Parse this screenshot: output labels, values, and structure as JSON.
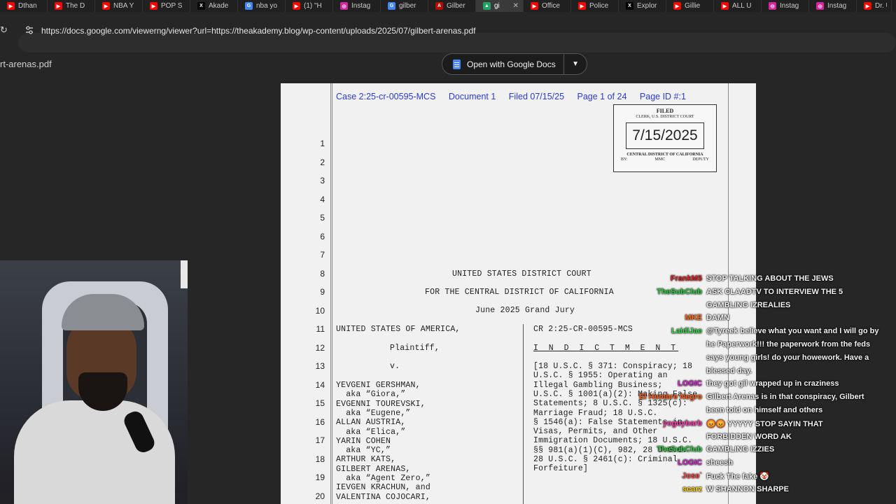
{
  "tabs": [
    {
      "title": "Dthan",
      "icon": "youtube-icon",
      "color": "#ff0000"
    },
    {
      "title": "The D",
      "icon": "youtube-icon",
      "color": "#ff0000"
    },
    {
      "title": "NBA Y",
      "icon": "youtube-icon",
      "color": "#ff0000"
    },
    {
      "title": "POP S",
      "icon": "youtube-icon",
      "color": "#ff0000"
    },
    {
      "title": "Akade",
      "icon": "x-icon",
      "color": "#000000"
    },
    {
      "title": "nba yo",
      "icon": "google-icon",
      "color": "#4285f4"
    },
    {
      "title": "(1) \"H",
      "icon": "youtube-icon",
      "color": "#ff0000"
    },
    {
      "title": "Instag",
      "icon": "instagram-icon",
      "color": "#d6249f"
    },
    {
      "title": "gilber",
      "icon": "google-icon",
      "color": "#4285f4"
    },
    {
      "title": "Gilber",
      "icon": "adobe-icon",
      "color": "#b30b00"
    },
    {
      "title": "gi",
      "icon": "drive-icon",
      "color": "#1fa463",
      "active": true
    },
    {
      "title": "Office",
      "icon": "youtube-icon",
      "color": "#ff0000"
    },
    {
      "title": "Police",
      "icon": "youtube-icon",
      "color": "#ff0000"
    },
    {
      "title": "Explor",
      "icon": "x-icon",
      "color": "#000000"
    },
    {
      "title": "Gillie",
      "icon": "youtube-icon",
      "color": "#ff0000"
    },
    {
      "title": "ALL U",
      "icon": "youtube-icon",
      "color": "#ff0000"
    },
    {
      "title": "Instag",
      "icon": "instagram-icon",
      "color": "#d6249f"
    },
    {
      "title": "Instag",
      "icon": "instagram-icon",
      "color": "#d6249f"
    },
    {
      "title": "Dr. U",
      "icon": "youtube-icon",
      "color": "#ff0000"
    }
  ],
  "url": "https://docs.google.com/viewerng/viewer?url=https://theakademy.blog/wp-content/uploads/2025/07/gilbert-arenas.pdf",
  "viewer": {
    "filename": "rt-arenas.pdf",
    "open_button": "Open with Google Docs"
  },
  "document": {
    "header": {
      "case": "Case 2:25-cr-00595-MCS",
      "document": "Document 1",
      "filed": "Filed 07/15/25",
      "page": "Page 1 of 24",
      "page_id": "Page ID #:1"
    },
    "stamp": {
      "filed": "FILED",
      "clerk": "CLERK, U.S. DISTRICT COURT",
      "date": "7/15/2025",
      "district": "CENTRAL DISTRICT OF CALIFORNIA",
      "by": "BY:",
      "initials": "MMC",
      "deputy": "DEPUTY"
    },
    "line_numbers": [
      "1",
      "2",
      "3",
      "4",
      "5",
      "6",
      "7",
      "8",
      "9",
      "10",
      "11",
      "12",
      "13",
      "14",
      "15",
      "16",
      "17",
      "18",
      "19",
      "20"
    ],
    "court": "UNITED STATES DISTRICT COURT",
    "district": "FOR THE CENTRAL DISTRICT OF CALIFORNIA",
    "jury": "June 2025 Grand Jury",
    "plaintiff_party": "UNITED STATES OF AMERICA,",
    "plaintiff_role": "Plaintiff,",
    "versus": "v.",
    "defendants": [
      "YEVGENI GERSHMAN,",
      "  aka “Giora,”",
      "EVGENNI TOUREVSKI,",
      "  aka “Eugene,”",
      "ALLAN AUSTRIA,",
      "  aka “Elica,”",
      "YARIN COHEN",
      "  aka “YC,”",
      "ARTHUR KATS,",
      "GILBERT ARENAS,",
      "  aka “Agent Zero,”",
      "IEVGEN KRACHUN, and",
      "VALENTINA COJOCARI,"
    ],
    "case_number": "CR 2:25-CR-00595-MCS",
    "title": "I N D I C T M E N T",
    "charges": [
      "[18 U.S.C. § 371: Conspiracy; 18",
      "U.S.C. § 1955: Operating an",
      "Illegal Gambling Business;",
      "U.S.C. § 1001(a)(2): Making False",
      "Statements; 8 U.S.C. § 1325(c):",
      "Marriage Fraud; 18 U.S.C.",
      "§ 1546(a): False Statements in",
      "Visas, Permits, and Other",
      "Immigration Documents; 18 U.S.C.",
      "§§ 981(a)(1)(C), 982, 28 U.S.C.",
      "28 U.S.C. § 2461(c): Criminal",
      "Forfeiture]"
    ]
  },
  "chat": [
    {
      "user": "FrankM5",
      "color": "#e02020",
      "text": "STOP TALKING ABOUT THE JEWS"
    },
    {
      "user": "TheSubClub",
      "color": "#2ecc40",
      "text": "ASK CLAADTV TO INTERVIEW THE 5"
    },
    {
      "user": "",
      "color": "#ffffff",
      "text": "GAMBLING IZREALIES"
    },
    {
      "user": "MKE",
      "color": "#ff6b1a",
      "text": "DAMN"
    },
    {
      "user": "LaidiJae",
      "color": "#3ad84a",
      "text": "@Tyreek believe what you want and I will go by"
    },
    {
      "user": "",
      "color": "#ffffff",
      "text": "he Paperwork!!! the paperwork from the feds"
    },
    {
      "user": "",
      "color": "#ffffff",
      "text": "says young girls! do your howework. Have a"
    },
    {
      "user": "",
      "color": "#ffffff",
      "text": "blessed day."
    },
    {
      "user": "LOGIC",
      "color": "#d21fd2",
      "text": "they got gil wrapped up in craziness"
    },
    {
      "user": "El Hombre Negro",
      "color": "#ff5e1a",
      "text": "Gilbert Arenas is in that conspiracy, Gilbert"
    },
    {
      "user": "",
      "color": "#ffffff",
      "text": "been told on himself and others"
    },
    {
      "user": "yoguybarb",
      "color": "#ff3ab0",
      "text": "😡😡 YYYYY STOP SAYIN THAT"
    },
    {
      "user": "",
      "color": "#ffffff",
      "text": "FORBIDDEN WORD AK"
    },
    {
      "user": "TheSubClub",
      "color": "#2ecc40",
      "text": "GAMBLING IZZIES"
    },
    {
      "user": "LOGIC",
      "color": "#d21fd2",
      "text": "sheesh"
    },
    {
      "user": "Jose`",
      "color": "#ff4a4a",
      "text": "Fuck The fake 🤡"
    },
    {
      "user": "scarz",
      "color": "#ffd400",
      "text": "W SHANNON SHARPE"
    }
  ]
}
